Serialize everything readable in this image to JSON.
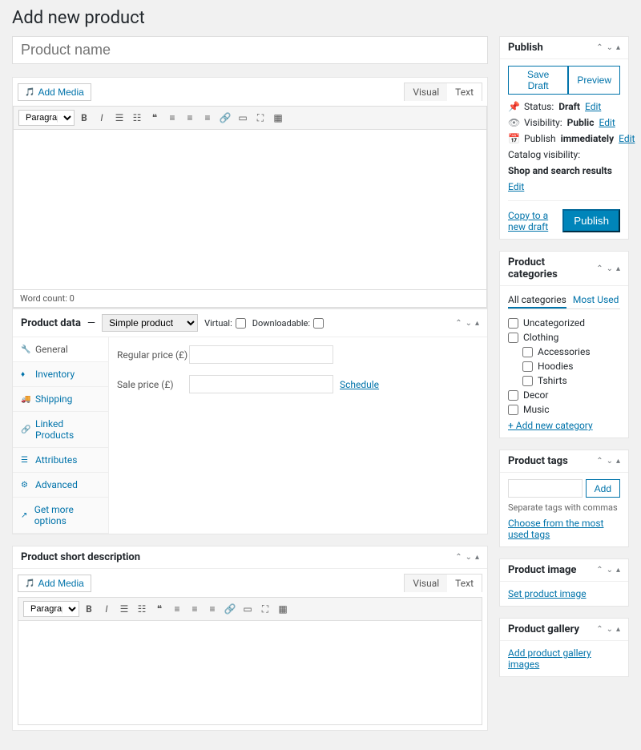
{
  "page_title": "Add new product",
  "title_placeholder": "Product name",
  "add_media": "Add Media",
  "editor": {
    "tabs": [
      "Visual",
      "Text"
    ],
    "format_select": "Paragraph",
    "word_count": "Word count: 0"
  },
  "product_data": {
    "title": "Product data",
    "type_options": [
      "Simple product"
    ],
    "virtual": "Virtual:",
    "downloadable": "Downloadable:",
    "tabs": [
      "General",
      "Inventory",
      "Shipping",
      "Linked Products",
      "Attributes",
      "Advanced",
      "Get more options"
    ],
    "regular_price": "Regular price (£)",
    "sale_price": "Sale price (£)",
    "schedule": "Schedule"
  },
  "short_desc": {
    "title": "Product short description"
  },
  "publish": {
    "title": "Publish",
    "save_draft": "Save Draft",
    "preview": "Preview",
    "status_label": "Status:",
    "status_value": "Draft",
    "visibility_label": "Visibility:",
    "visibility_value": "Public",
    "publish_label": "Publish",
    "publish_value": "immediately",
    "catalog_label": "Catalog visibility:",
    "catalog_value": "Shop and search results",
    "edit": "Edit",
    "copy": "Copy to a new draft",
    "publish_btn": "Publish"
  },
  "categories": {
    "title": "Product categories",
    "tabs": [
      "All categories",
      "Most Used"
    ],
    "items": [
      "Uncategorized",
      "Clothing",
      "Accessories",
      "Hoodies",
      "Tshirts",
      "Decor",
      "Music"
    ],
    "add_new": "+ Add new category"
  },
  "tags": {
    "title": "Product tags",
    "add": "Add",
    "help": "Separate tags with commas",
    "choose": "Choose from the most used tags"
  },
  "image": {
    "title": "Product image",
    "link": "Set product image"
  },
  "gallery": {
    "title": "Product gallery",
    "link": "Add product gallery images"
  }
}
